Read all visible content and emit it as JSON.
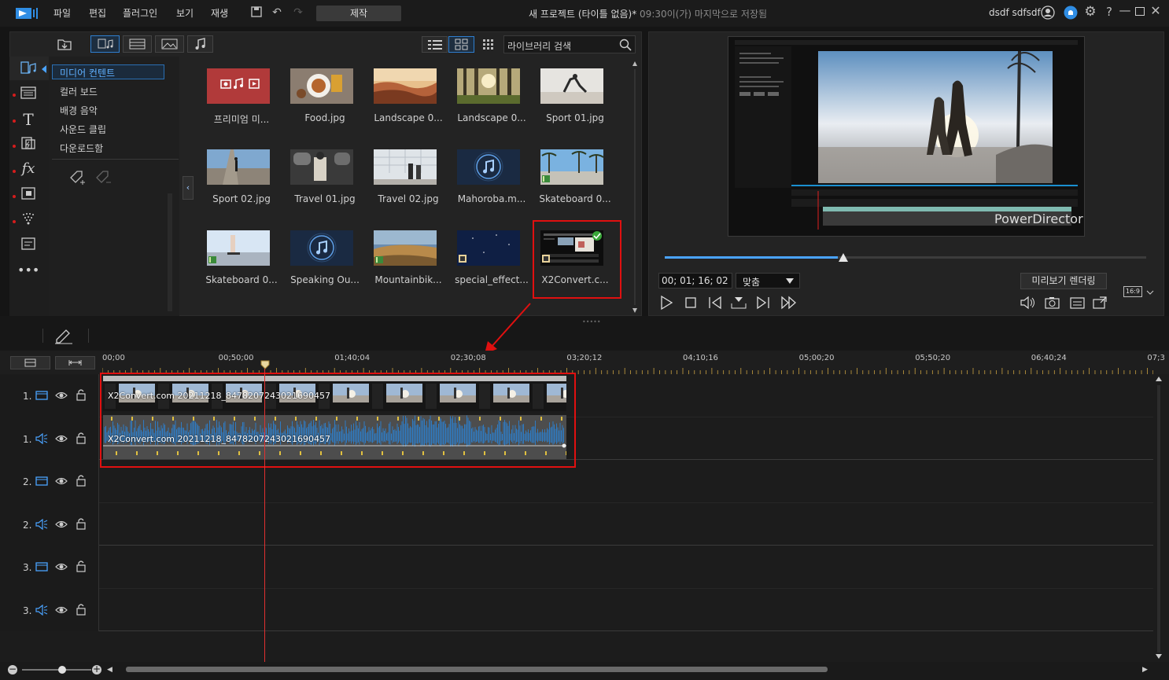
{
  "menu": {
    "file": "파일",
    "edit": "편집",
    "plugin": "플러그인",
    "view": "보기",
    "playback": "재생",
    "produce": "제작"
  },
  "project": {
    "title": "새 프로젝트 (타이틀 없음)*",
    "saved": "09:30이(가) 마지막으로 저장됨"
  },
  "user": {
    "name": "dsdf sdfsdf"
  },
  "library": {
    "search_placeholder": "라이브러리 검색",
    "categories": [
      "미디어 컨텐트",
      "컬러 보드",
      "배경 음악",
      "사운드 클립",
      "다운로드함"
    ],
    "items": [
      {
        "label": "프리미엄 미...",
        "kind": "premium"
      },
      {
        "label": "Food.jpg",
        "kind": "food"
      },
      {
        "label": "Landscape 0...",
        "kind": "canyon"
      },
      {
        "label": "Landscape 0...",
        "kind": "forest"
      },
      {
        "label": "Sport 01.jpg",
        "kind": "sport1"
      },
      {
        "label": "Sport 02.jpg",
        "kind": "skate"
      },
      {
        "label": "Travel 01.jpg",
        "kind": "travel1"
      },
      {
        "label": "Travel 02.jpg",
        "kind": "travel2"
      },
      {
        "label": "Mahoroba.m...",
        "kind": "audio"
      },
      {
        "label": "Skateboard 0...",
        "kind": "palms"
      },
      {
        "label": "Skateboard 0...",
        "kind": "skate2"
      },
      {
        "label": "Speaking Ou...",
        "kind": "audio"
      },
      {
        "label": "Mountainbik...",
        "kind": "mtb"
      },
      {
        "label": "special_effect...",
        "kind": "night"
      },
      {
        "label": "X2Convert.c...",
        "kind": "x2"
      }
    ]
  },
  "preview": {
    "timecode": "00; 01; 16; 02",
    "fit": "맞춤",
    "render_btn": "미리보기 렌더링",
    "aspect": "16:9",
    "watermark": "PowerDirector",
    "progress": 0.36
  },
  "timeline": {
    "ruler": [
      "00;00",
      "00;50;00",
      "01;40;04",
      "02;30;08",
      "03;20;12",
      "04;10;16",
      "05;00;20",
      "05;50;20",
      "06;40;24",
      "07;3"
    ],
    "clip_name": "X2Convert.com 20211218_847820724302169045​7",
    "tracks": [
      "1.",
      "1.",
      "2.",
      "2.",
      "3.",
      "3."
    ]
  }
}
